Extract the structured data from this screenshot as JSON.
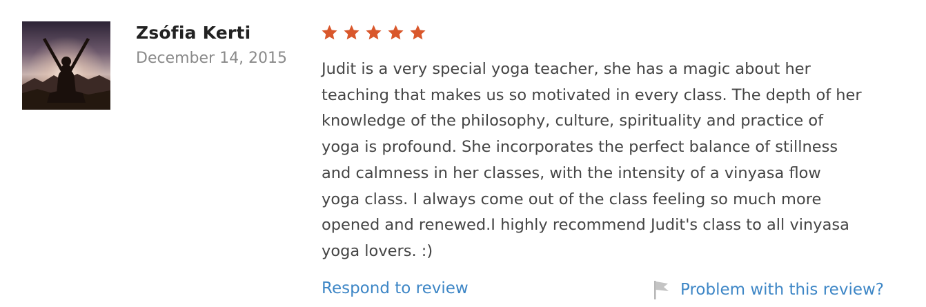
{
  "review": {
    "reviewer_name": "Zsófia Kerti",
    "date": "December 14, 2015",
    "rating": 5,
    "rating_max": 5,
    "star_icon": "star-icon",
    "star_color": "#d9572b",
    "text_lines": [
      "Judit is a very special yoga teacher, she has a magic about her",
      "teaching that makes us so motivated in every class. The depth of her",
      "knowledge of the philosophy, culture, spirituality and practice of",
      "yoga is profound. She incorporates the perfect balance of stillness",
      "and calmness in her classes, with the intensity of a vinyasa flow",
      "yoga class. I always come out of the class feeling so much more",
      "opened and renewed.I highly recommend Judit's class to all vinyasa",
      "yoga lovers. :)"
    ],
    "respond_label": "Respond to review",
    "problem_label": "Problem with this review?",
    "problem_icon": "flag-icon",
    "link_color": "#3d86c6"
  }
}
